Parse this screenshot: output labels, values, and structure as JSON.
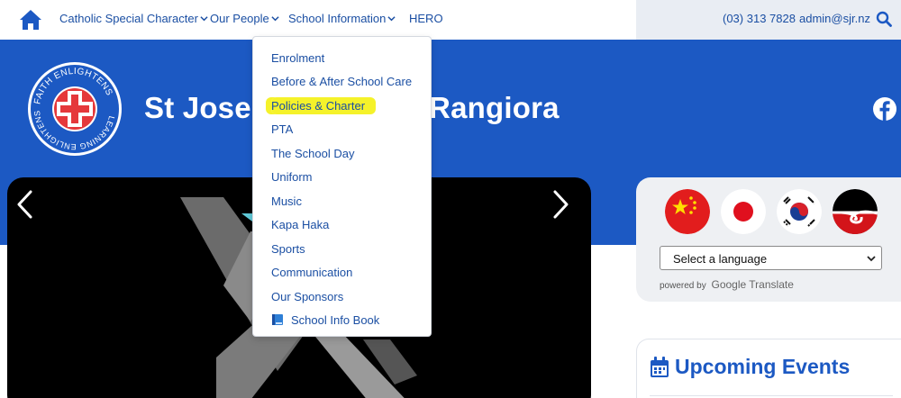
{
  "nav": {
    "items": [
      {
        "label": "Catholic Special Character"
      },
      {
        "label": "Our People"
      },
      {
        "label": "School Information"
      },
      {
        "label": "HERO"
      }
    ]
  },
  "contact": {
    "phone": "(03) 313 7828",
    "email": "admin@sjr.nz"
  },
  "header": {
    "school_name": "St Joseph's School Rangiora",
    "logo_text": "FAITH ENLIGHTENS LEARNING ENLIGHTENS"
  },
  "dropdown": {
    "items": [
      {
        "label": "Enrolment"
      },
      {
        "label": "Before & After School Care"
      },
      {
        "label": "Policies & Charter",
        "highlighted": true
      },
      {
        "label": "PTA"
      },
      {
        "label": "The School Day"
      },
      {
        "label": "Uniform"
      },
      {
        "label": "Music"
      },
      {
        "label": "Kapa Haka"
      },
      {
        "label": "Sports"
      },
      {
        "label": "Communication"
      },
      {
        "label": "Our Sponsors"
      },
      {
        "label": "School Info Book",
        "icon": "book-icon"
      }
    ]
  },
  "translate": {
    "flags": [
      "china-flag-icon",
      "japan-flag-icon",
      "korea-flag-icon",
      "maori-flag-icon"
    ],
    "select_label": "Select a language",
    "powered_by": "powered by",
    "brand": "Google Translate"
  },
  "events": {
    "title": "Upcoming Events"
  },
  "colors": {
    "primary_blue": "#1c59c3",
    "link_blue": "#1b4fa3",
    "highlight": "#f5f22a"
  }
}
